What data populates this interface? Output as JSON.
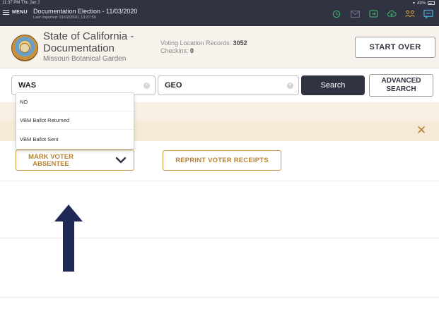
{
  "status": {
    "time_date": "11:37 PM  Thu Jan 2",
    "battery": "49%"
  },
  "menu": {
    "label": "MENU"
  },
  "election": {
    "title": "Documentation Election - 11/03/2020",
    "last_imported": "Last Imported: 01/02/2020, 13:37:59"
  },
  "top_icons": [
    "history-icon",
    "mail-icon",
    "sync-icon",
    "cloud-upload-icon",
    "users-icon",
    "chat-icon"
  ],
  "header": {
    "org_line1": "State of California -",
    "org_line2": "Documentation",
    "location": "Missouri Botanical Garden",
    "records_label": "Voting Location Records:",
    "records_value": "3052",
    "checkins_label": "Checkins:",
    "checkins_value": "0",
    "start_over": "START OVER"
  },
  "search": {
    "last_name_value": "WAS",
    "first_name_value": "GEO",
    "search_label": "Search",
    "advanced_line1": "ADVANCED",
    "advanced_line2": "SEARCH"
  },
  "dropdown": {
    "options": [
      "NO",
      "VBM Ballot Returned",
      "VBM Ballot Sent"
    ]
  },
  "actions": {
    "mark_absentee_line1": "MARK VOTER",
    "mark_absentee_line2": "ABSENTEE",
    "reprint": "REPRINT VOTER RECEIPTS"
  },
  "colors": {
    "topbar": "#2f3342",
    "accent_gold": "#b68333",
    "arrow_navy": "#1e2a55",
    "band": "#f4ead7"
  }
}
